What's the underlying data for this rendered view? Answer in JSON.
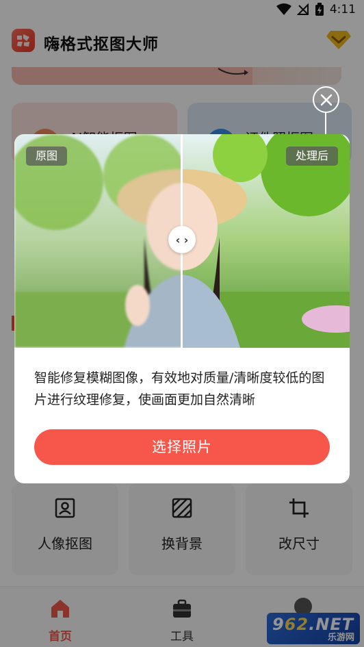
{
  "status_bar": {
    "time": "4:11"
  },
  "header": {
    "title": "嗨格式抠图大师"
  },
  "background": {
    "feature_cards": [
      {
        "label": "AI智能抠图"
      },
      {
        "label": "证件照抠图"
      }
    ],
    "tools": [
      {
        "label": "人像抠图",
        "icon": "portrait-icon"
      },
      {
        "label": "换背景",
        "icon": "background-icon"
      },
      {
        "label": "改尺寸",
        "icon": "crop-icon"
      }
    ]
  },
  "bottom_nav": {
    "items": [
      {
        "label": "首页",
        "icon": "home-icon",
        "active": true
      },
      {
        "label": "工具",
        "icon": "toolbox-icon",
        "active": false
      }
    ],
    "watermark": {
      "main_prefix": "9",
      "main_num": "62",
      "main_suffix": ".NET",
      "sub": "乐游网"
    }
  },
  "dialog": {
    "before_tag": "原图",
    "after_tag": "处理后",
    "handle_glyph": "‹ ›",
    "description": "智能修复模糊图像，有效地对质量/清晰度较低的图片进行纹理修复，使画面更加自然清晰",
    "button_label": "选择照片"
  },
  "colors": {
    "accent": "#f7574a",
    "overlay": "rgba(0,0,0,0.42)"
  }
}
